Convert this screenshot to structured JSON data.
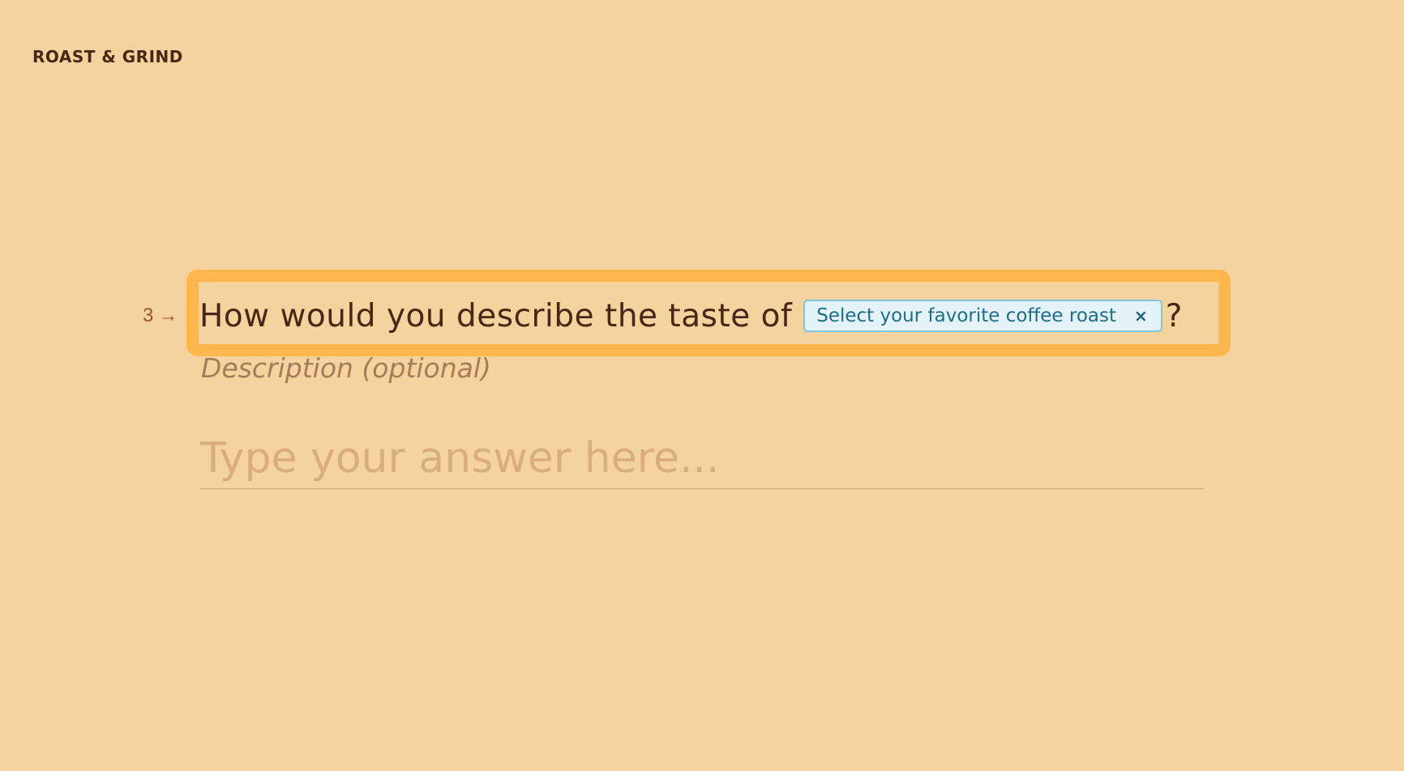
{
  "brand": {
    "logo_text": "ROAST & GRIND"
  },
  "question": {
    "number": "3",
    "arrow": "→",
    "title": "How would you describe the taste of",
    "recall_chip_label": "Select your favorite coffee roast",
    "recall_chip_close": "×",
    "title_suffix": "?",
    "description_placeholder": "Description (optional)"
  },
  "answer": {
    "placeholder": "Type your answer here...",
    "value": ""
  },
  "colors": {
    "background": "#f4d39f",
    "text": "#4a2616",
    "accent_focus": "#ffb74d",
    "chip_background": "#e4f3f8",
    "chip_border": "#7ec7dc",
    "chip_text": "#1d6e87"
  }
}
